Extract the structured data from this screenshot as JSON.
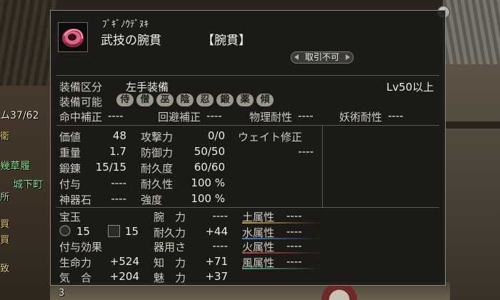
{
  "background": {
    "hud_count": "ム37/62",
    "hud_k1": "衛",
    "hud_ms": "幾草履",
    "hud_loc": "城下町",
    "hud_k2": "所",
    "hud_k3": "買",
    "hud_k4": "買",
    "hud_k5": "致",
    "hud_num": "3"
  },
  "tooltip": {
    "close_glyph": "×",
    "item_icon": "wrist-guard-icon",
    "reading": "ﾌﾞｷﾞﾉｳﾃﾞﾇｷ",
    "name": "武技の腕貫",
    "type_tag": "【腕貫】",
    "untradable": "取引不可",
    "slot_label": "装備区分",
    "slot_value": "左手装備",
    "level_req": "Lv50以上",
    "class_label": "装備可能",
    "classes": [
      "侍",
      "僧",
      "巫",
      "陰",
      "忍",
      "鍛",
      "薬",
      "傾"
    ],
    "resists": [
      {
        "label": "命中補正",
        "value": "----"
      },
      {
        "label": "回避補正",
        "value": "----"
      },
      {
        "label": "物理耐性",
        "value": "----"
      },
      {
        "label": "妖術耐性",
        "value": "----"
      }
    ],
    "stats_left": [
      {
        "label": "価値",
        "value": "48"
      },
      {
        "label": "重量",
        "value": "1.7"
      },
      {
        "label": "鍛錬",
        "value": "15/15"
      },
      {
        "label": "付与",
        "value": "----"
      },
      {
        "label": "神器石",
        "value": "----"
      }
    ],
    "stats_mid": [
      {
        "label": "攻撃力",
        "value": "0/0"
      },
      {
        "label": "防御力",
        "value": "50/50"
      },
      {
        "label": "耐久度",
        "value": "60/60"
      },
      {
        "label": "耐久性",
        "value": "100 %"
      },
      {
        "label": "強度",
        "value": "100 %"
      }
    ],
    "weight_label": "ウェイト修正",
    "weight_value": "----",
    "gem_label": "宝玉",
    "gem_round": "15",
    "gem_square": "15",
    "enchant_label": "付与効果",
    "enchants": [
      {
        "label": "生命力",
        "value": "+524"
      },
      {
        "label": "気　合",
        "value": "+204"
      }
    ],
    "attrs": [
      {
        "label": "腕　力",
        "value": "----"
      },
      {
        "label": "耐久力",
        "value": "+44"
      },
      {
        "label": "器用さ",
        "value": "----"
      },
      {
        "label": "知　力",
        "value": "+71"
      },
      {
        "label": "魅　力",
        "value": "+37"
      }
    ],
    "elements": [
      {
        "label": "土属性",
        "value": "----",
        "color": "#c9a24a"
      },
      {
        "label": "水属性",
        "value": "----",
        "color": "#4a7fd0"
      },
      {
        "label": "火属性",
        "value": "----",
        "color": "#c84848"
      },
      {
        "label": "風属性",
        "value": "----",
        "color": "#4ab07a"
      }
    ]
  }
}
